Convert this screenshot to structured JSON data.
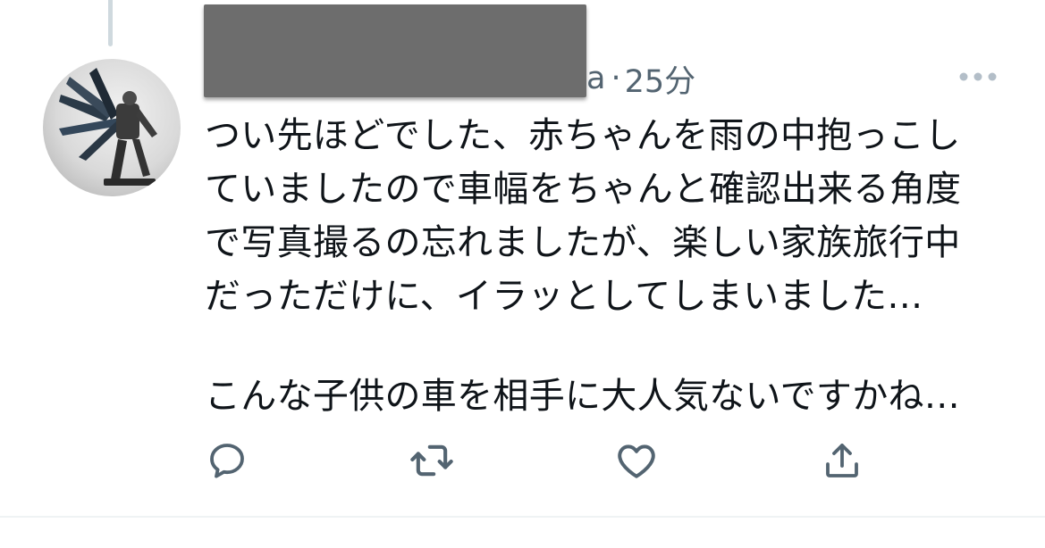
{
  "tweet": {
    "handle_visible_tail": "a",
    "separator": "·",
    "timestamp": "25分",
    "text_lines": [
      "つい先ほどでした、赤ちゃんを雨の中抱っこし",
      "ていましたので車幅をちゃんと確認出来る角度",
      "で写真撮るの忘れましたが、楽しい家族旅行中",
      "だっただけに、イラッとしてしまいました…"
    ],
    "text_paragraph_2": "こんな子供の車を相手に大人気ないですかね…"
  },
  "icons": {
    "more": "more-horizontal-icon",
    "reply": "reply-icon",
    "retweet": "retweet-icon",
    "like": "heart-icon",
    "share": "share-icon",
    "avatar": "avatar-image"
  },
  "colors": {
    "text_primary": "#0f1419",
    "text_secondary": "#536471",
    "thread_line": "#cfd9de",
    "divider": "#eff3f4",
    "redaction": "#6d6d6d"
  }
}
